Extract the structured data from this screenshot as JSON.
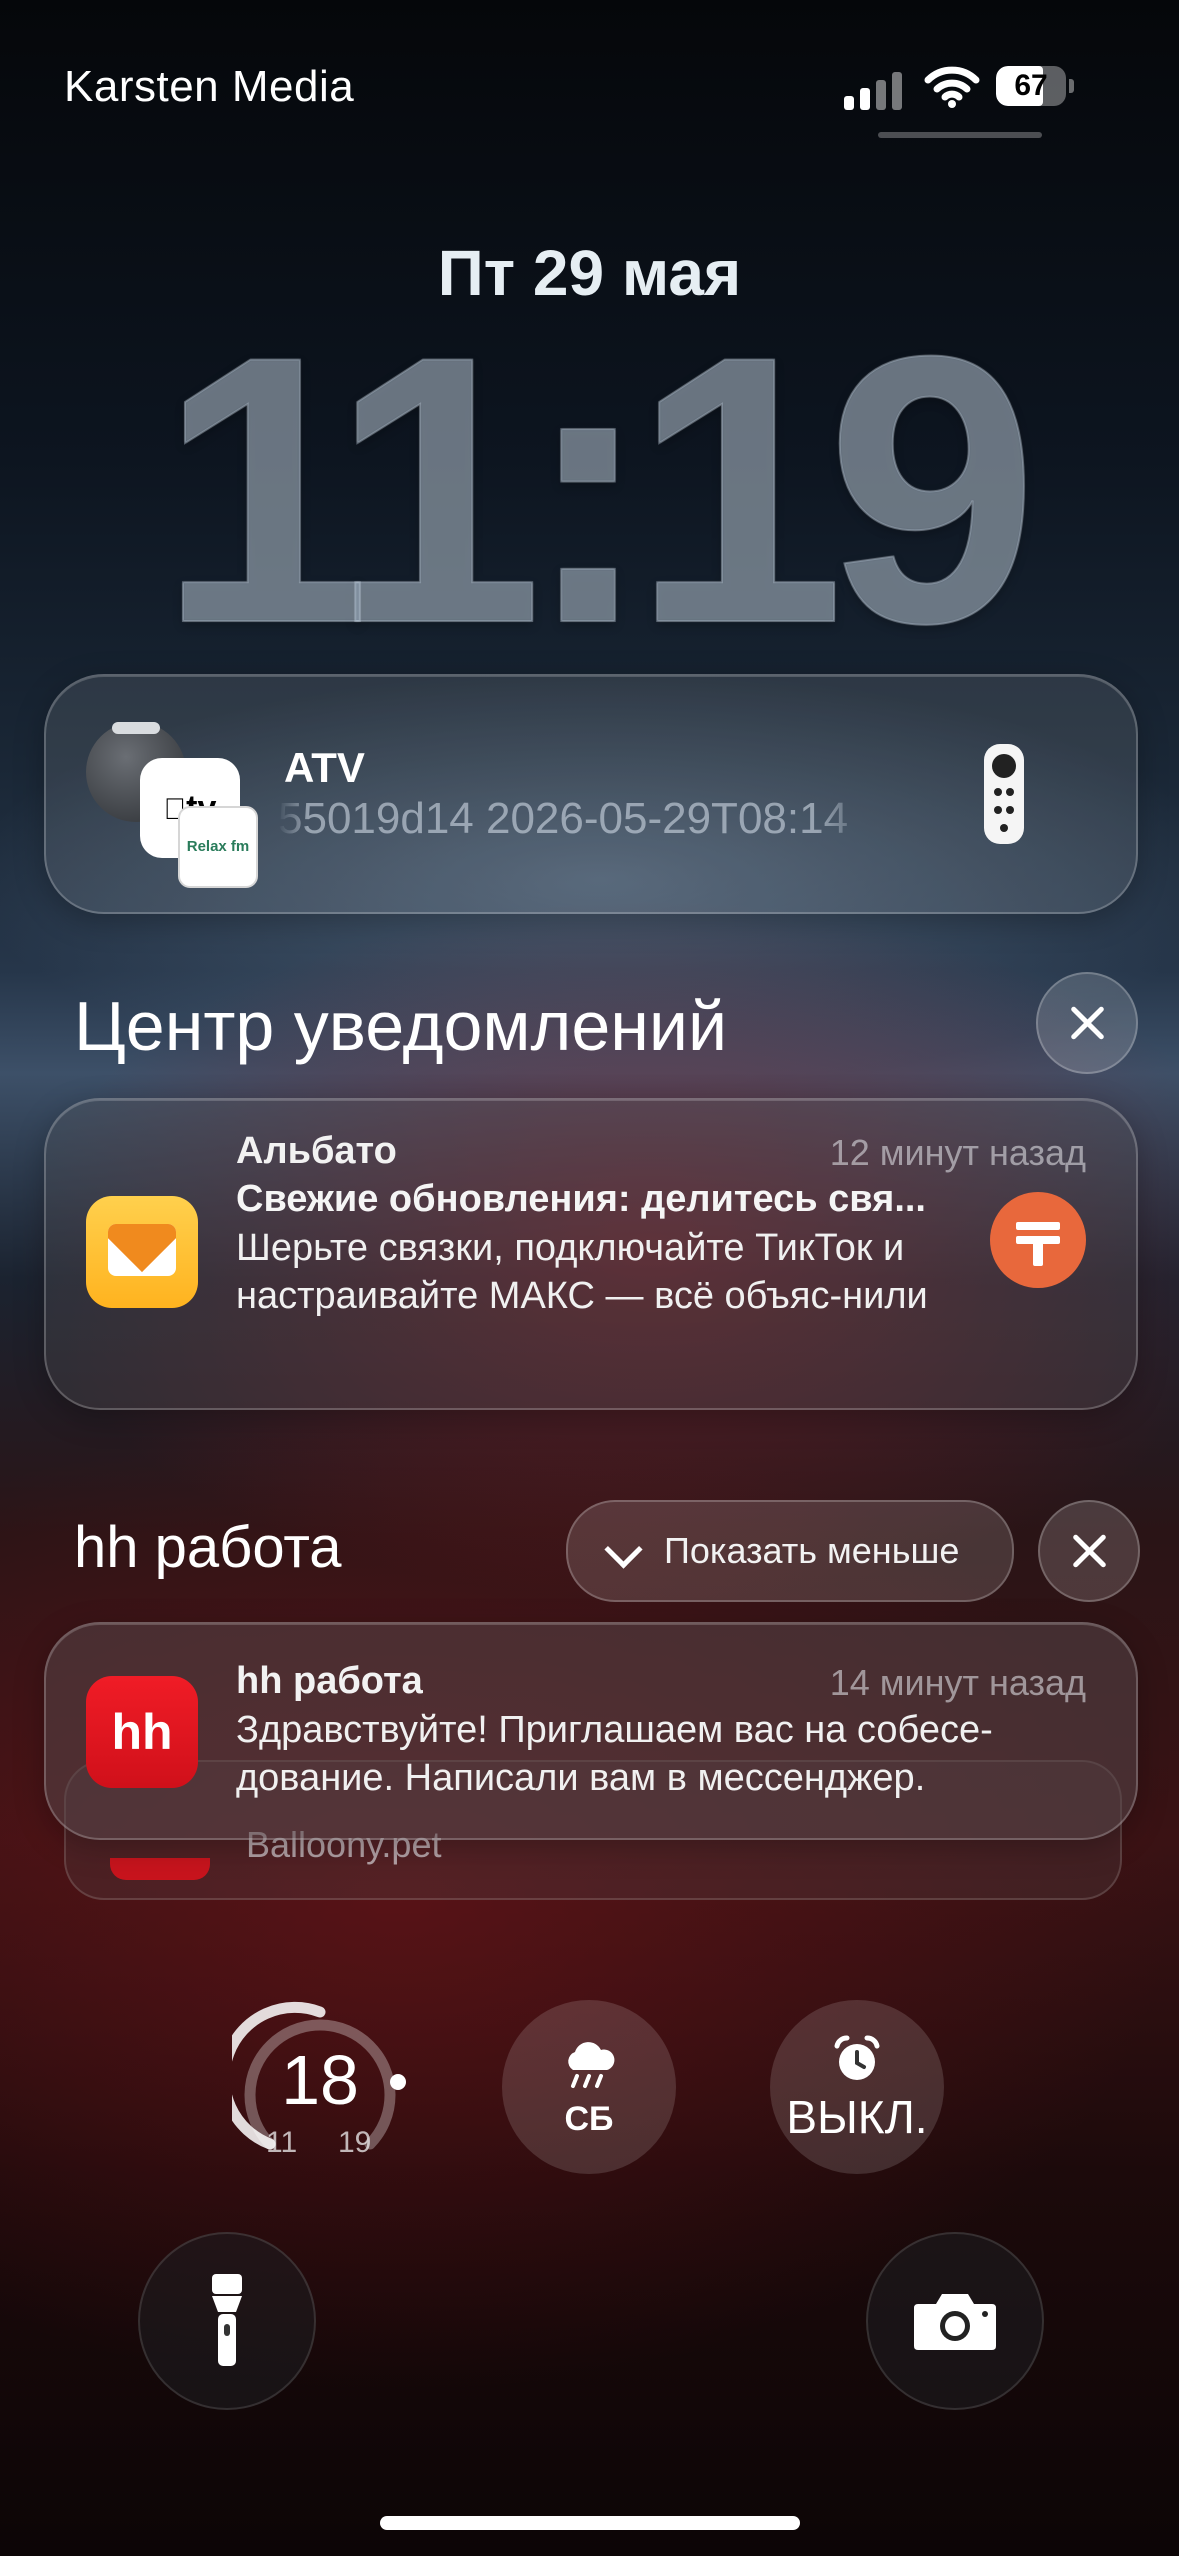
{
  "status_bar": {
    "carrier": "Karsten Media",
    "battery_percent": 67,
    "battery_label": "67"
  },
  "lock_screen": {
    "date": "Пт 29 мая",
    "time": "11:19"
  },
  "now_playing": {
    "title": "ATV",
    "subtitle": "55019d14 2026-05-29T08:14",
    "tv_icon_label": "tv",
    "relax_label": "Relax fm"
  },
  "notification_center": {
    "title": "Центр уведомлений"
  },
  "notifications": [
    {
      "app": "Альбато",
      "time": "12 минут назад",
      "headline": "Свежие обновления: делитесь свя...",
      "body": "Шерьте связки, подключайте ТикТок и настраивайте МАКС — всё объяс-нили"
    },
    {
      "app": "hh работа",
      "time": "14 минут назад",
      "body": "Здравствуйте! Приглашаем вас на собесе-дование. Написали вам в мессенджер.",
      "icon_label": "hh"
    }
  ],
  "hh_group": {
    "title": "hh работа",
    "show_less": "Показать меньше",
    "stacked_peek": "Balloony.pet"
  },
  "widgets": {
    "temperature": "18",
    "temp_low": "11",
    "temp_high": "19",
    "weather_day": "СБ",
    "alarm_status": "ВЫКЛ."
  }
}
